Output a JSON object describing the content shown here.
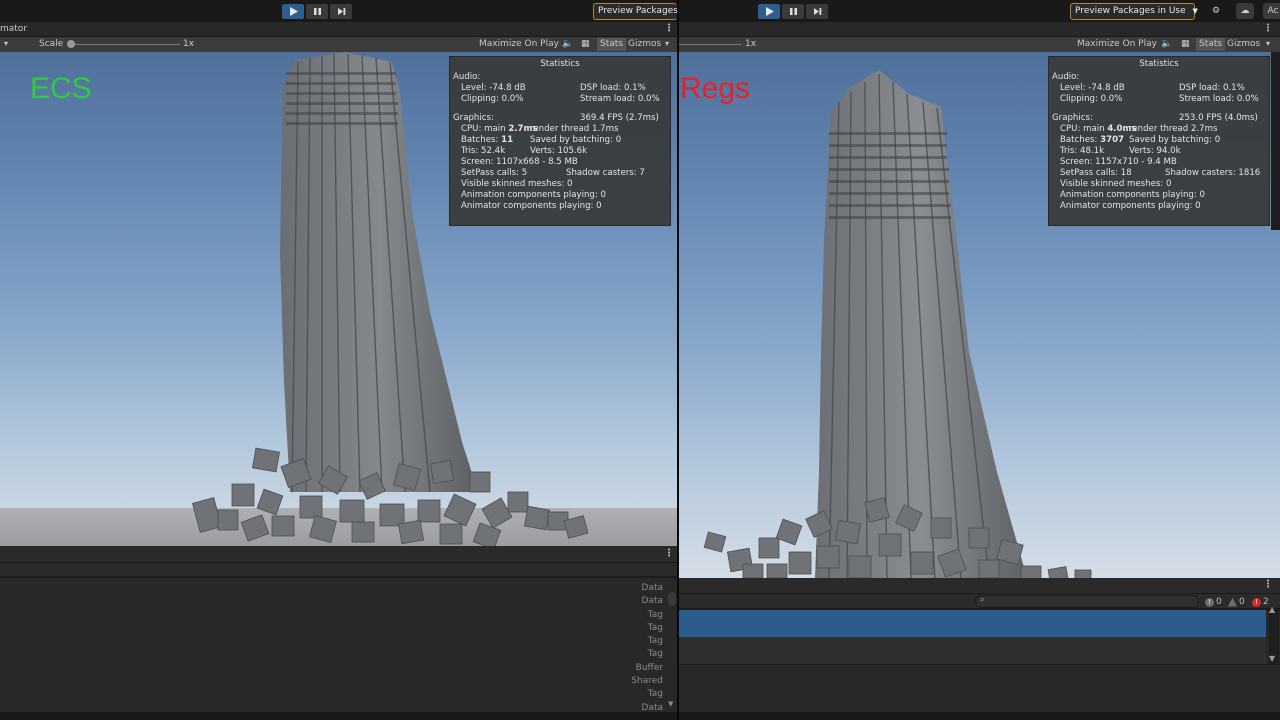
{
  "left": {
    "window_title": "mator",
    "preview_label": "Preview Packages",
    "scale_label": "Scale",
    "scale_value": "1x",
    "maximize_label": "Maximize On Play",
    "stats_label": "Stats",
    "gizmos_label": "Gizmos",
    "overlay_label": "ECS",
    "stats_panel": {
      "title": "Statistics",
      "audio_header": "Audio:",
      "level": "Level: -74.8 dB",
      "dsp": "DSP load: 0.1%",
      "clipping": "Clipping: 0.0%",
      "stream": "Stream load: 0.0%",
      "graphics_header": "Graphics:",
      "fps": "369.4 FPS (2.7ms)",
      "cpu_pre": "CPU: main ",
      "cpu_main": "2.7ms",
      "render": "render thread 1.7ms",
      "batches_pre": "Batches: ",
      "batches": "11",
      "saved": "Saved by batching: 0",
      "tris": "Tris: 52.4k",
      "verts": "Verts: 105.6k",
      "screen": "Screen: 1107x668 - 8.5 MB",
      "setpass": "SetPass calls: 5",
      "shadow": "Shadow casters: 7",
      "skinned": "Visible skinned meshes: 0",
      "anim": "Animation components playing: 0",
      "animator": "Animator components playing: 0"
    },
    "component_types": [
      "Data",
      "Data",
      "Tag",
      "Tag",
      "Tag",
      "Tag",
      "Buffer",
      "Shared",
      "Tag",
      "Data"
    ]
  },
  "right": {
    "preview_label": "Preview Packages in Use",
    "top_right_label": "Ac",
    "scale_value": "1x",
    "maximize_label": "Maximize On Play",
    "stats_label": "Stats",
    "gizmos_label": "Gizmos",
    "overlay_label": "Regs",
    "stats_panel": {
      "title": "Statistics",
      "audio_header": "Audio:",
      "level": "Level: -74.8 dB",
      "dsp": "DSP load: 0.1%",
      "clipping": "Clipping: 0.0%",
      "stream": "Stream load: 0.0%",
      "graphics_header": "Graphics:",
      "fps": "253.0 FPS (4.0ms)",
      "cpu_pre": "CPU: main ",
      "cpu_main": "4.0ms",
      "render": "render thread 2.7ms",
      "batches_pre": "Batches: ",
      "batches": "3707",
      "saved": "Saved by batching: 0",
      "tris": "Tris: 48.1k",
      "verts": "Verts: 94.0k",
      "screen": "Screen: 1157x710 - 9.4 MB",
      "setpass": "SetPass calls: 18",
      "shadow": "Shadow casters: 1816",
      "skinned": "Visible skinned meshes: 0",
      "anim": "Animation components playing: 0",
      "animator": "Animator components playing: 0"
    },
    "console": {
      "info_count": "0",
      "warn_count": "0",
      "error_count": "2"
    }
  },
  "colors": {
    "ecs_label": "#2ecc40",
    "regs_label": "#e8202a",
    "play_active": "#2e5d8f",
    "preview_border": "#b8862a",
    "console_selected": "#2c5c8c"
  }
}
